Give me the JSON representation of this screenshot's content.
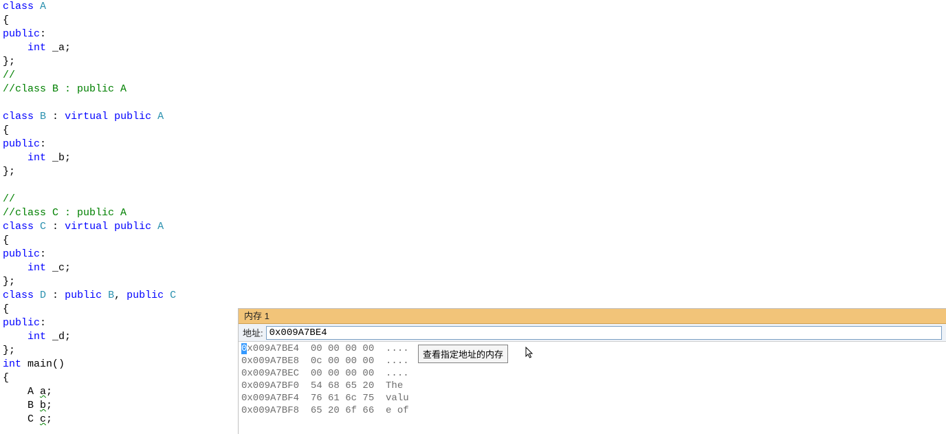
{
  "code": {
    "l1a": "class",
    "l1b": "A",
    "l2": "{",
    "l3": "public",
    "l3b": ":",
    "l4a": "    ",
    "l4b": "int",
    "l4c": " _a;",
    "l5": "};",
    "l6": "//",
    "l7": "//class B : public A",
    "blank1": "",
    "l9a": "class",
    "l9b": "B",
    "l9c": " : ",
    "l9d": "virtual",
    "l9e": "public",
    "l9f": "A",
    "l10": "{",
    "l11a": "public",
    "l11b": ":",
    "l12a": "    ",
    "l12b": "int",
    "l12c": " _b;",
    "l13": "};",
    "blank2": "",
    "l15": "//",
    "l16": "//class C : public A",
    "l17a": "class",
    "l17b": "C",
    "l17c": " : ",
    "l17d": "virtual",
    "l17e": "public",
    "l17f": "A",
    "l18": "{",
    "l19a": "public",
    "l19b": ":",
    "l20a": "    ",
    "l20b": "int",
    "l20c": " _c;",
    "l21": "};",
    "l22a": "class",
    "l22b": "D",
    "l22c": " : ",
    "l22d": "public",
    "l22e": "B",
    "l22f": ", ",
    "l22g": "public",
    "l22h": "C",
    "l23": "{",
    "l24a": "public",
    "l24b": ":",
    "l25a": "    ",
    "l25b": "int",
    "l25c": " _d;",
    "l26": "};",
    "l27a": "int",
    "l27b": "main",
    "l27c": "()",
    "l28": "{",
    "l29a": "    A ",
    "l29b": "a",
    "l29c": ";",
    "l30a": "    B ",
    "l30b": "b",
    "l30c": ";",
    "l31a": "    C ",
    "l31b": "c",
    "l31c": ";"
  },
  "memory": {
    "title": "内存 1",
    "address_label": "地址:",
    "address_value": "0x009A7BE4",
    "tooltip": "查看指定地址的内存",
    "rows": [
      {
        "addr_first": "0",
        "addr_rest": "x009A7BE4",
        "hex": "00 00 00 00",
        "ascii": "...."
      },
      {
        "addr_first": "0",
        "addr_rest": "x009A7BE8",
        "hex": "0c 00 00 00",
        "ascii": "...."
      },
      {
        "addr_first": "0",
        "addr_rest": "x009A7BEC",
        "hex": "00 00 00 00",
        "ascii": "...."
      },
      {
        "addr_first": "0",
        "addr_rest": "x009A7BF0",
        "hex": "54 68 65 20",
        "ascii": "The "
      },
      {
        "addr_first": "0",
        "addr_rest": "x009A7BF4",
        "hex": "76 61 6c 75",
        "ascii": "valu"
      },
      {
        "addr_first": "0",
        "addr_rest": "x009A7BF8",
        "hex": "65 20 6f 66",
        "ascii": "e of"
      }
    ]
  }
}
